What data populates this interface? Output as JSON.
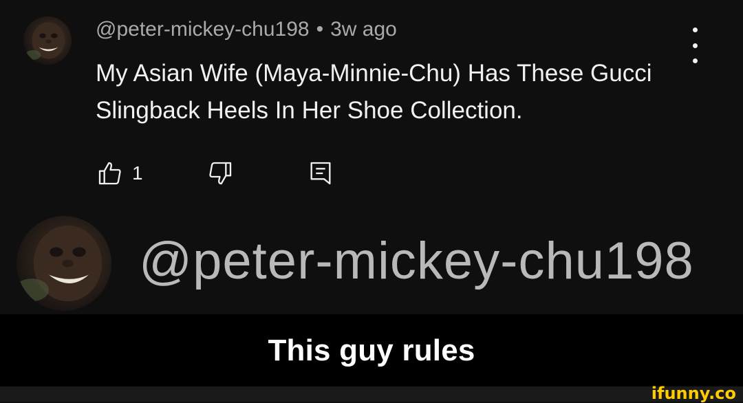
{
  "comment": {
    "author_handle": "@peter-mickey-chu198",
    "separator": "•",
    "timestamp": "3w ago",
    "text": "My Asian Wife (Maya-Minnie-Chu) Has These Gucci Slingback Heels In Her Shoe Collection.",
    "like_count": "1"
  },
  "zoomed": {
    "handle": "@peter-mickey-chu198"
  },
  "caption": {
    "text": "This guy rules"
  },
  "watermark": {
    "text": "ifunny.co"
  },
  "icons": {
    "like": "thumbs-up-icon",
    "dislike": "thumbs-down-icon",
    "reply": "reply-icon",
    "more": "kebab-menu-icon"
  },
  "colors": {
    "background": "#0f0f0f",
    "primary_text": "#f1f1f1",
    "secondary_text": "#aaaaaa",
    "caption_bg": "#000000",
    "watermark": "#ffcc00"
  }
}
